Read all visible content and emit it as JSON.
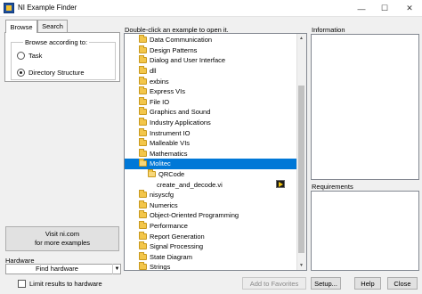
{
  "window": {
    "title": "NI Example Finder",
    "min_glyph": "—",
    "max_glyph": "☐",
    "close_glyph": "✕"
  },
  "tabs": [
    {
      "label": "Browse",
      "active": true
    },
    {
      "label": "Search",
      "active": false
    }
  ],
  "browse": {
    "label": "Browse according to:",
    "options": [
      {
        "label": "Task",
        "checked": false
      },
      {
        "label": "Directory Structure",
        "checked": true
      }
    ]
  },
  "visit": {
    "line1": "Visit ni.com",
    "line2": "for more examples"
  },
  "hardware": {
    "label": "Hardware",
    "value": "Find hardware"
  },
  "limit": {
    "label": "Limit results to hardware",
    "checked": false
  },
  "tree": {
    "caption": "Double-click an example to open it.",
    "items": [
      {
        "label": "Data Communication",
        "depth": 0,
        "type": "folder"
      },
      {
        "label": "Design Patterns",
        "depth": 0,
        "type": "folder"
      },
      {
        "label": "Dialog and User Interface",
        "depth": 0,
        "type": "folder"
      },
      {
        "label": "dll",
        "depth": 0,
        "type": "folder"
      },
      {
        "label": "exbins",
        "depth": 0,
        "type": "folder"
      },
      {
        "label": "Express VIs",
        "depth": 0,
        "type": "folder"
      },
      {
        "label": "File IO",
        "depth": 0,
        "type": "folder"
      },
      {
        "label": "Graphics and Sound",
        "depth": 0,
        "type": "folder"
      },
      {
        "label": "Industry Applications",
        "depth": 0,
        "type": "folder"
      },
      {
        "label": "Instrument IO",
        "depth": 0,
        "type": "folder"
      },
      {
        "label": "Malleable VIs",
        "depth": 0,
        "type": "folder"
      },
      {
        "label": "Mathematics",
        "depth": 0,
        "type": "folder"
      },
      {
        "label": "Molitec",
        "depth": 0,
        "type": "folder-open",
        "selected": true
      },
      {
        "label": "QRCode",
        "depth": 1,
        "type": "folder-open"
      },
      {
        "label": "create_and_decode.vi",
        "depth": 2,
        "type": "vi"
      },
      {
        "label": "nisyscfg",
        "depth": 0,
        "type": "folder"
      },
      {
        "label": "Numerics",
        "depth": 0,
        "type": "folder"
      },
      {
        "label": "Object-Oriented Programming",
        "depth": 0,
        "type": "folder"
      },
      {
        "label": "Performance",
        "depth": 0,
        "type": "folder"
      },
      {
        "label": "Report Generation",
        "depth": 0,
        "type": "folder"
      },
      {
        "label": "Signal Processing",
        "depth": 0,
        "type": "folder"
      },
      {
        "label": "State Diagram",
        "depth": 0,
        "type": "folder"
      },
      {
        "label": "Strings",
        "depth": 0,
        "type": "folder"
      }
    ]
  },
  "information": {
    "label": "Information"
  },
  "requirements": {
    "label": "Requirements"
  },
  "buttons": {
    "add_favorites": "Add to Favorites",
    "setup": "Setup...",
    "help": "Help",
    "close": "Close"
  },
  "colors": {
    "selection": "#0078d7",
    "folder": "#f3c64a"
  }
}
